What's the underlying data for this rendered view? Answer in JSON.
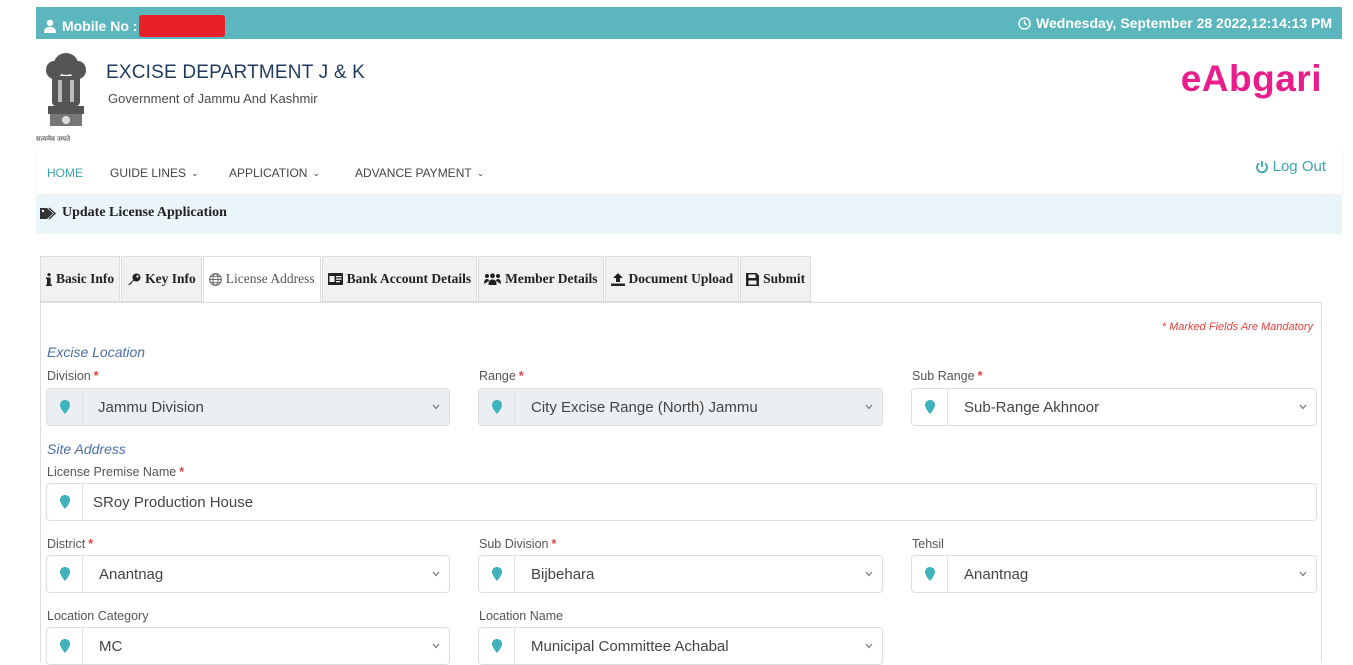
{
  "topbar": {
    "mobile_label": "Mobile No :",
    "datetime": "Wednesday, September 28 2022,12:14:13 PM"
  },
  "header": {
    "department": "EXCISE DEPARTMENT J & K",
    "government": "Government of Jammu And Kashmir",
    "emblem_caption": "सत्यमेव जयते",
    "brand": "eAbgari"
  },
  "nav": {
    "items": [
      {
        "label": "HOME",
        "dropdown": false
      },
      {
        "label": "GUIDE LINES",
        "dropdown": true
      },
      {
        "label": "APPLICATION",
        "dropdown": true
      },
      {
        "label": "ADVANCE PAYMENT",
        "dropdown": true
      }
    ],
    "logout": "Log Out"
  },
  "page": {
    "heading": "Update License Application"
  },
  "tabs": [
    {
      "label": "Basic Info",
      "icon": "info-icon"
    },
    {
      "label": "Key Info",
      "icon": "key-icon"
    },
    {
      "label": "License Address",
      "icon": "globe-icon"
    },
    {
      "label": "Bank Account Details",
      "icon": "id-card-icon"
    },
    {
      "label": "Member Details",
      "icon": "users-icon"
    },
    {
      "label": "Document Upload",
      "icon": "upload-icon"
    },
    {
      "label": "Submit",
      "icon": "save-icon"
    }
  ],
  "form": {
    "mandatory_note": "* Marked Fields Are Mandatory",
    "excise_location_title": "Excise Location",
    "site_address_title": "Site Address",
    "division": {
      "label": "Division",
      "value": "Jammu Division"
    },
    "range": {
      "label": "Range",
      "value": "City Excise Range (North) Jammu"
    },
    "sub_range": {
      "label": "Sub Range",
      "value": "Sub-Range Akhnoor"
    },
    "premise_name": {
      "label": "License Premise Name",
      "value": "SRoy Production House"
    },
    "district": {
      "label": "District",
      "value": "Anantnag"
    },
    "sub_division": {
      "label": "Sub Division",
      "value": "Bijbehara"
    },
    "tehsil": {
      "label": "Tehsil",
      "value": "Anantnag"
    },
    "location_category": {
      "label": "Location Category",
      "value": "MC"
    },
    "location_name": {
      "label": "Location Name",
      "value": "Municipal Committee Achabal"
    },
    "required_mark": "*"
  },
  "colors": {
    "topbar": "#5bb7bd",
    "brand": "#e91e8c",
    "accent": "#3aa6b0",
    "required": "#e0413c",
    "marker": "#3fb3bb"
  }
}
